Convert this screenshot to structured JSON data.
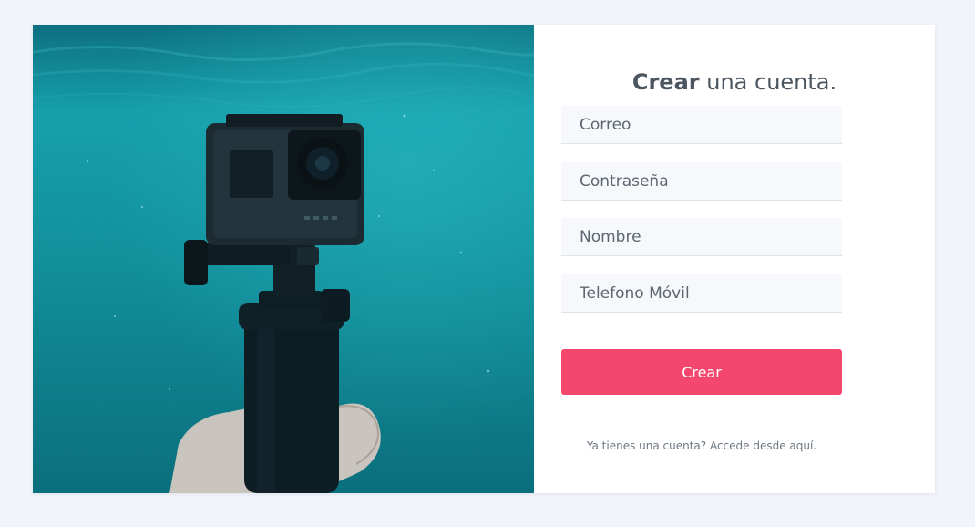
{
  "header": {
    "title_bold": "Crear",
    "title_rest": " una cuenta."
  },
  "form": {
    "fields": [
      {
        "placeholder": "Correo",
        "value": ""
      },
      {
        "placeholder": "Contraseña",
        "value": ""
      },
      {
        "placeholder": "Nombre",
        "value": ""
      },
      {
        "placeholder": "Telefono Móvil",
        "value": ""
      }
    ],
    "submit_label": "Crear",
    "login_link": "Ya tienes una cuenta? Accede desde aquí."
  },
  "colors": {
    "accent": "#f3476d",
    "background": "#f1f4fb",
    "field_bg": "#f6f8fb"
  },
  "image": {
    "subject": "action-camera-underwater-photo"
  }
}
